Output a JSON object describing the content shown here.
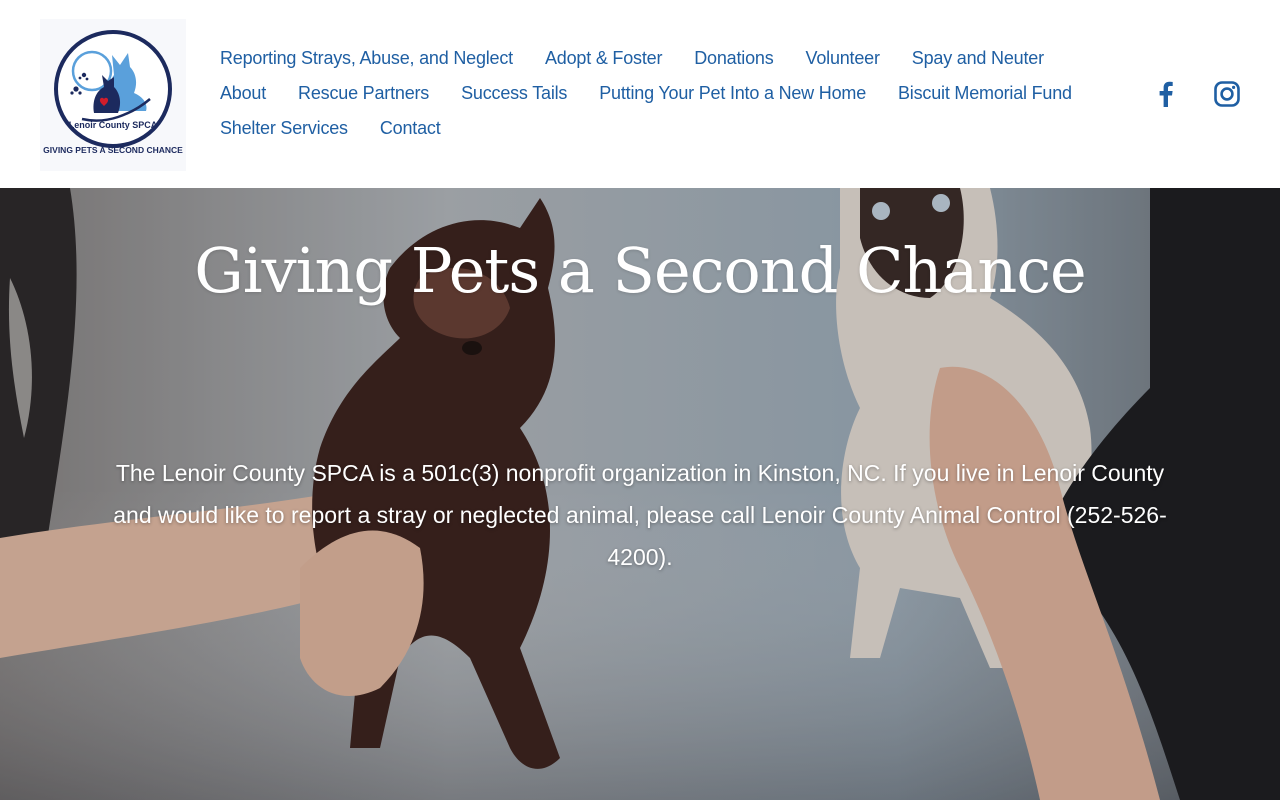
{
  "logo": {
    "org_name": "Lenoir County SPCA",
    "tagline": "GIVING PETS A SECOND CHANCE"
  },
  "nav": {
    "rows": [
      [
        "Reporting Strays, Abuse, and Neglect",
        "Adopt & Foster",
        "Donations",
        "Volunteer",
        "Spay and Neuter"
      ],
      [
        "About",
        "Rescue Partners",
        "Success Tails",
        "Putting Your Pet Into a New Home",
        "Biscuit Memorial Fund"
      ],
      [
        "Shelter Services",
        "Contact"
      ]
    ]
  },
  "social": {
    "icons": [
      "facebook-icon",
      "instagram-icon"
    ]
  },
  "hero": {
    "title": "Giving Pets a Second Chance",
    "body": "The Lenoir County SPCA is a 501c(3) nonprofit organization in Kinston, NC. If you live in Lenoir County and would like to report a stray or neglected animal, please call Lenoir County Animal Control (252-526-4200)."
  },
  "colors": {
    "nav_link": "#1f5fa3",
    "logo_navy": "#1c2a5e",
    "logo_blue": "#5aa0db",
    "logo_heart": "#d11d2b",
    "hero_text": "#ffffff"
  }
}
